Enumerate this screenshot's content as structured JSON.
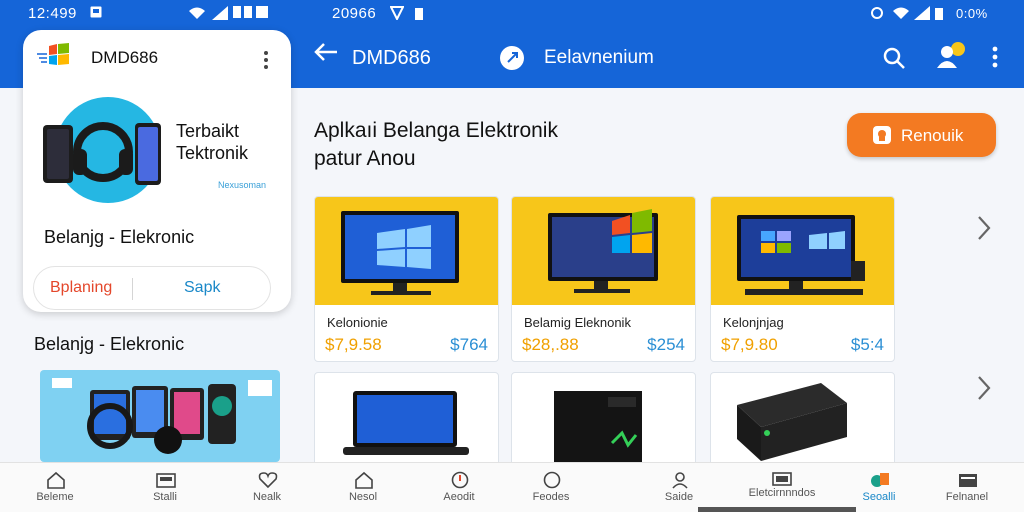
{
  "status_left": {
    "time": "12:499"
  },
  "status_right": {
    "time": "20966",
    "right_text": "0:0%"
  },
  "app_card": {
    "app_name": "DMD686",
    "hero_text_line1": "Terbaikt",
    "hero_text_line2": "Tektronik",
    "hero_small": "Nexusoman",
    "subtitle": "Belanjg - Elekronic",
    "btn_primary": "Bplaning",
    "btn_secondary": "Sapk"
  },
  "left_heading": "Belanjg - Elekronic",
  "topbar": {
    "title": "DMD686",
    "chip_label": "Eelavnenium"
  },
  "main": {
    "heading_line1": "Aplkaıi Belanga Elektronik",
    "heading_line2": "patur Anou",
    "cta_label": "Renouik"
  },
  "products": [
    {
      "name": "Kelonionie",
      "price": "$7,9.58",
      "alt_price": "$764"
    },
    {
      "name": "Belamig Eleknonik",
      "price": "$28,.88",
      "alt_price": "$254"
    },
    {
      "name": "Kelonjnjag",
      "price": "$7,9.80",
      "alt_price": "$5:4"
    }
  ],
  "bottom_nav": [
    {
      "label": "Beleme",
      "icon": "home-icon"
    },
    {
      "label": "Stalli",
      "icon": "store-icon"
    },
    {
      "label": "Nealk",
      "icon": "heart-icon"
    },
    {
      "label": "Nesol",
      "icon": "home-icon"
    },
    {
      "label": "Aeodit",
      "icon": "alert-icon"
    },
    {
      "label": "Feodes",
      "icon": "chat-icon"
    },
    {
      "label": "Saide",
      "icon": "user-icon"
    },
    {
      "label": "Eletcirnnndos",
      "icon": "electronics-icon"
    },
    {
      "label": "Seoalli",
      "icon": "category-icon"
    },
    {
      "label": "Felnanel",
      "icon": "cart-icon"
    }
  ],
  "colors": {
    "primary_blue": "#1565d8",
    "accent_orange": "#f37a22",
    "price_yellow": "#f0a000",
    "price_blue": "#2b8fd4",
    "card_yellow": "#f7c61a"
  }
}
